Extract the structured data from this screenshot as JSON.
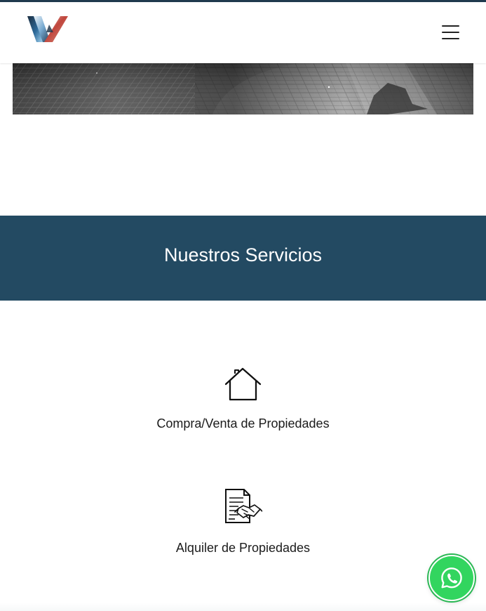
{
  "header": {
    "logo_icon": "brand-w-logo-icon",
    "menu_icon": "hamburger-menu-icon"
  },
  "hero": {
    "image_description": ""
  },
  "services_section": {
    "title": "Nuestros Servicios",
    "background_color": "#234a62",
    "items": [
      {
        "icon": "house-icon",
        "title": "Compra/Venta de Propiedades"
      },
      {
        "icon": "contract-handshake-icon",
        "title": "Alquiler de Propiedades"
      }
    ]
  },
  "floating_actions": {
    "whatsapp_icon": "whatsapp-icon",
    "whatsapp_color": "#32d55f"
  }
}
